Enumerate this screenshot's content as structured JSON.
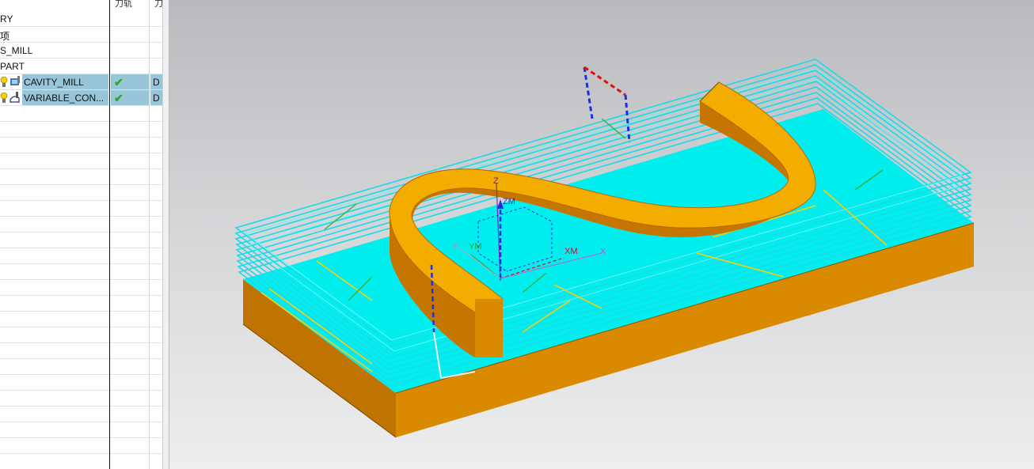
{
  "navigator": {
    "columns": [
      "刀轨",
      "刀"
    ],
    "rows": [
      {
        "label": "RY"
      },
      {
        "label": "项"
      },
      {
        "label": "S_MILL"
      },
      {
        "label": "PART"
      }
    ],
    "operations": [
      {
        "label": "CAVITY_MILL",
        "status_icon": "check-icon",
        "col3": "D"
      },
      {
        "label": "VARIABLE_CON...",
        "status_icon": "check-icon",
        "col3": "D"
      }
    ]
  },
  "viewport": {
    "axis_labels": {
      "z": "Z",
      "zm": "ZM",
      "ym": "YM",
      "xm": "XM",
      "x": "X",
      "y": "Y"
    },
    "colors": {
      "part": "#e4a000",
      "part_side": "#c57600",
      "toolpath": "#00f0f0",
      "background_top": "#b9babd",
      "background_bottom": "#eeeeef"
    }
  }
}
